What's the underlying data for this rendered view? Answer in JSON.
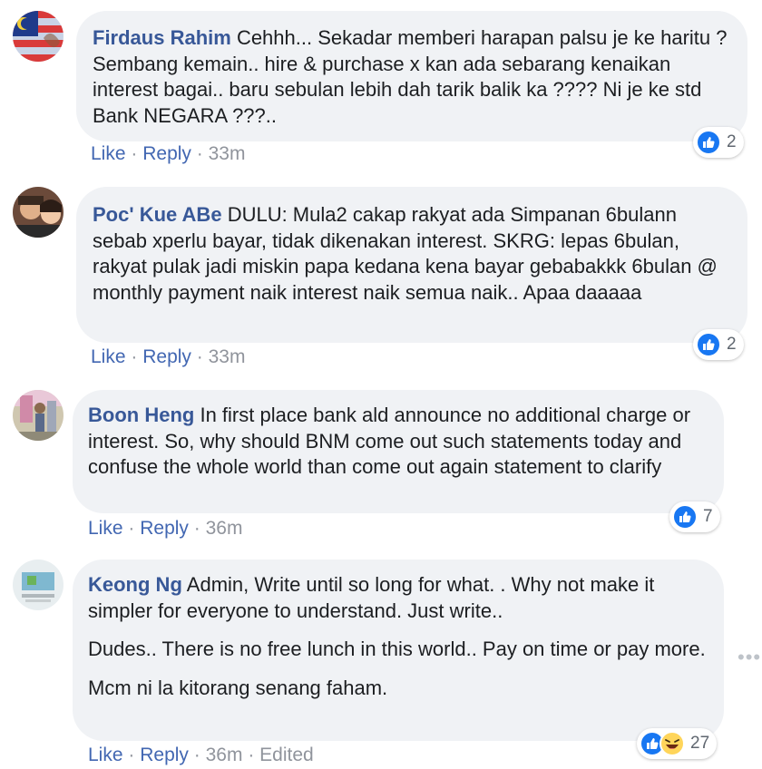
{
  "comments": [
    {
      "author": "Firdaus Rahim",
      "paragraphs": [
        "Cehhh... Sekadar memberi harapan palsu je ke haritu ? Sembang kemain.. hire & purchase x kan ada sebarang kenaikan interest bagai.. baru sebulan lebih dah tarik balik ka ???? Ni je ke std Bank NEGARA ???.."
      ],
      "like_label": "Like",
      "reply_label": "Reply",
      "time": "33m",
      "reaction_count": "2",
      "reactions": [
        "like-icon"
      ]
    },
    {
      "author": "Poc' Kue ABe",
      "paragraphs": [
        "DULU: Mula2 cakap rakyat ada Simpanan 6bulann sebab xperlu bayar, tidak dikenakan interest. SKRG: lepas 6bulan, rakyat pulak jadi miskin papa kedana kena bayar gebabakkk 6bulan @ monthly payment naik interest naik semua naik.. Apaa daaaaa"
      ],
      "like_label": "Like",
      "reply_label": "Reply",
      "time": "33m",
      "reaction_count": "2",
      "reactions": [
        "like-icon"
      ]
    },
    {
      "author": "Boon Heng",
      "paragraphs": [
        "In first place bank ald announce no additional charge or interest. So, why should BNM come out such statements today and confuse the whole world than come out again statement to clarify"
      ],
      "like_label": "Like",
      "reply_label": "Reply",
      "time": "36m",
      "reaction_count": "7",
      "reactions": [
        "like-icon"
      ]
    },
    {
      "author": "Keong Ng",
      "paragraphs": [
        "Admin, Write until so long for what. . Why not make it simpler for everyone to understand. Just write..",
        "Dudes.. There is no free lunch in this world.. Pay on time or pay more.",
        "Mcm ni la kitorang senang faham."
      ],
      "like_label": "Like",
      "reply_label": "Reply",
      "time": "36m",
      "edited_label": "Edited",
      "reaction_count": "27",
      "reactions": [
        "like-icon",
        "haha-icon"
      ]
    }
  ],
  "more_options": "•••",
  "colors": {
    "author": "#385898",
    "link": "#4267b2",
    "bubble": "#f0f2f5",
    "like_blue": "#1877f2",
    "haha_yellow": "#ffd55a",
    "meta_gray": "#90949c"
  }
}
